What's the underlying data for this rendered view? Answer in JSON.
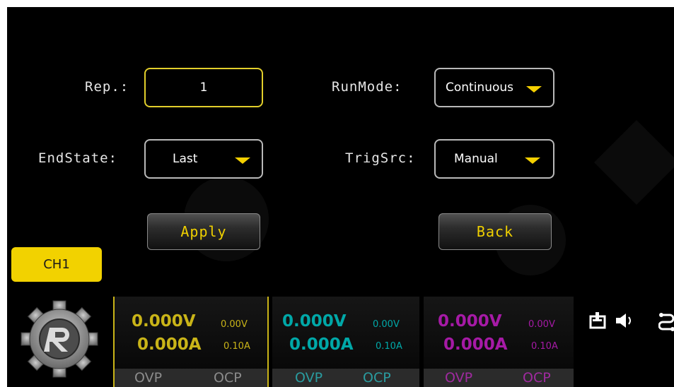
{
  "settings": {
    "rep_label": "Rep.:",
    "rep_value": "1",
    "runmode_label": "RunMode:",
    "runmode_value": "Continuous",
    "endstate_label": "EndState:",
    "endstate_value": "Last",
    "trigsrc_label": "TrigSrc:",
    "trigsrc_value": "Manual"
  },
  "buttons": {
    "apply": "Apply",
    "back": "Back"
  },
  "channel_tab": "CH1",
  "channels": [
    {
      "voltage": "0.000V",
      "current": "0.000A",
      "set_voltage": "0.00V",
      "set_current": "0.10A",
      "ovp": "OVP",
      "ocp": "OCP",
      "color": "#c9b418",
      "status_color": "#8c8c8c"
    },
    {
      "voltage": "0.000V",
      "current": "0.000A",
      "set_voltage": "0.00V",
      "set_current": "0.10A",
      "ovp": "OVP",
      "ocp": "OCP",
      "color": "#00a8a8",
      "status_color": "#2a9ca0"
    },
    {
      "voltage": "0.000V",
      "current": "0.000A",
      "set_voltage": "0.00V",
      "set_current": "0.10A",
      "ovp": "OVP",
      "ocp": "OCP",
      "color": "#a61aa6",
      "status_color": "#a02aa0"
    }
  ],
  "status_icons": [
    "usb-device-icon",
    "speaker-icon",
    "lan-icon"
  ],
  "colors": {
    "accent_yellow": "#f2d200",
    "background": "#000000",
    "border": "#b9b9b9"
  }
}
